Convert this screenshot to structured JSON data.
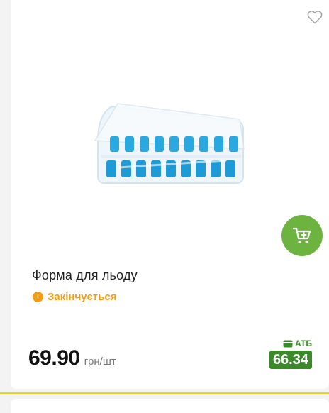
{
  "product": {
    "title": "Форма для льоду",
    "status": "Закінчується",
    "price": "69.90",
    "unit": "грн/шт",
    "promo": {
      "brand": "АТБ",
      "price": "66.34"
    }
  },
  "icons": {
    "favorite": "heart-outline-icon",
    "cart": "cart-plus-icon",
    "status": "warning-icon",
    "card": "card-icon"
  },
  "colors": {
    "cart_button": "#6cb33f",
    "status": "#f39c12",
    "promo": "#3a8a2a",
    "divider": "#f2d31b"
  }
}
